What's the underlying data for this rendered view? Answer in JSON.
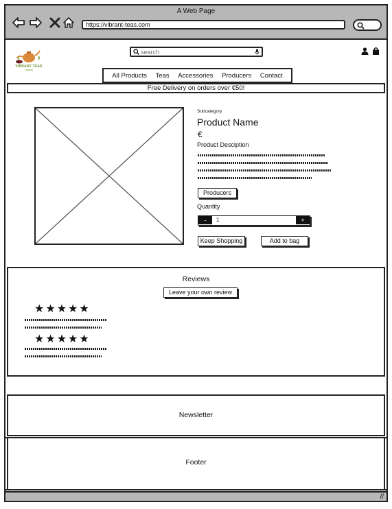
{
  "browser": {
    "window_title": "A Web Page",
    "url": "https://vibrant-teas.com",
    "nav_icons": [
      "back-arrow-icon",
      "forward-arrow-icon",
      "close-icon",
      "home-icon"
    ],
    "search_icon": "search-icon"
  },
  "header": {
    "logo_text": "VIBRANT TEAS",
    "logo_subtext": "Organic",
    "search_placeholder": "search",
    "icons": [
      "search-icon",
      "microphone-icon",
      "user-icon",
      "shopping-bag-icon"
    ]
  },
  "nav": {
    "items": [
      "All Products",
      "Teas",
      "Accessories",
      "Producers",
      "Contact"
    ]
  },
  "promo": {
    "text": "Free Delivery on orders over €50!"
  },
  "product": {
    "subcategory": "Subcategory",
    "name": "Product Name",
    "price": "€",
    "description_label": "Product Desciption",
    "producers_button": "Producers",
    "quantity_label": "Quantity",
    "minus_label": "-",
    "plus_label": "+",
    "quantity_value": "1",
    "keep_shopping_button": "Keep Shopping",
    "add_to_bag_button": "Add to bag"
  },
  "reviews": {
    "title": "Reviews",
    "leave_review_button": "Leave your own review",
    "items": [
      {
        "stars": "★★★★★",
        "rating": 5
      },
      {
        "stars": "★★★★★",
        "rating": 5
      }
    ]
  },
  "newsletter": {
    "label": "Newsletter"
  },
  "footer": {
    "label": "Footer"
  }
}
